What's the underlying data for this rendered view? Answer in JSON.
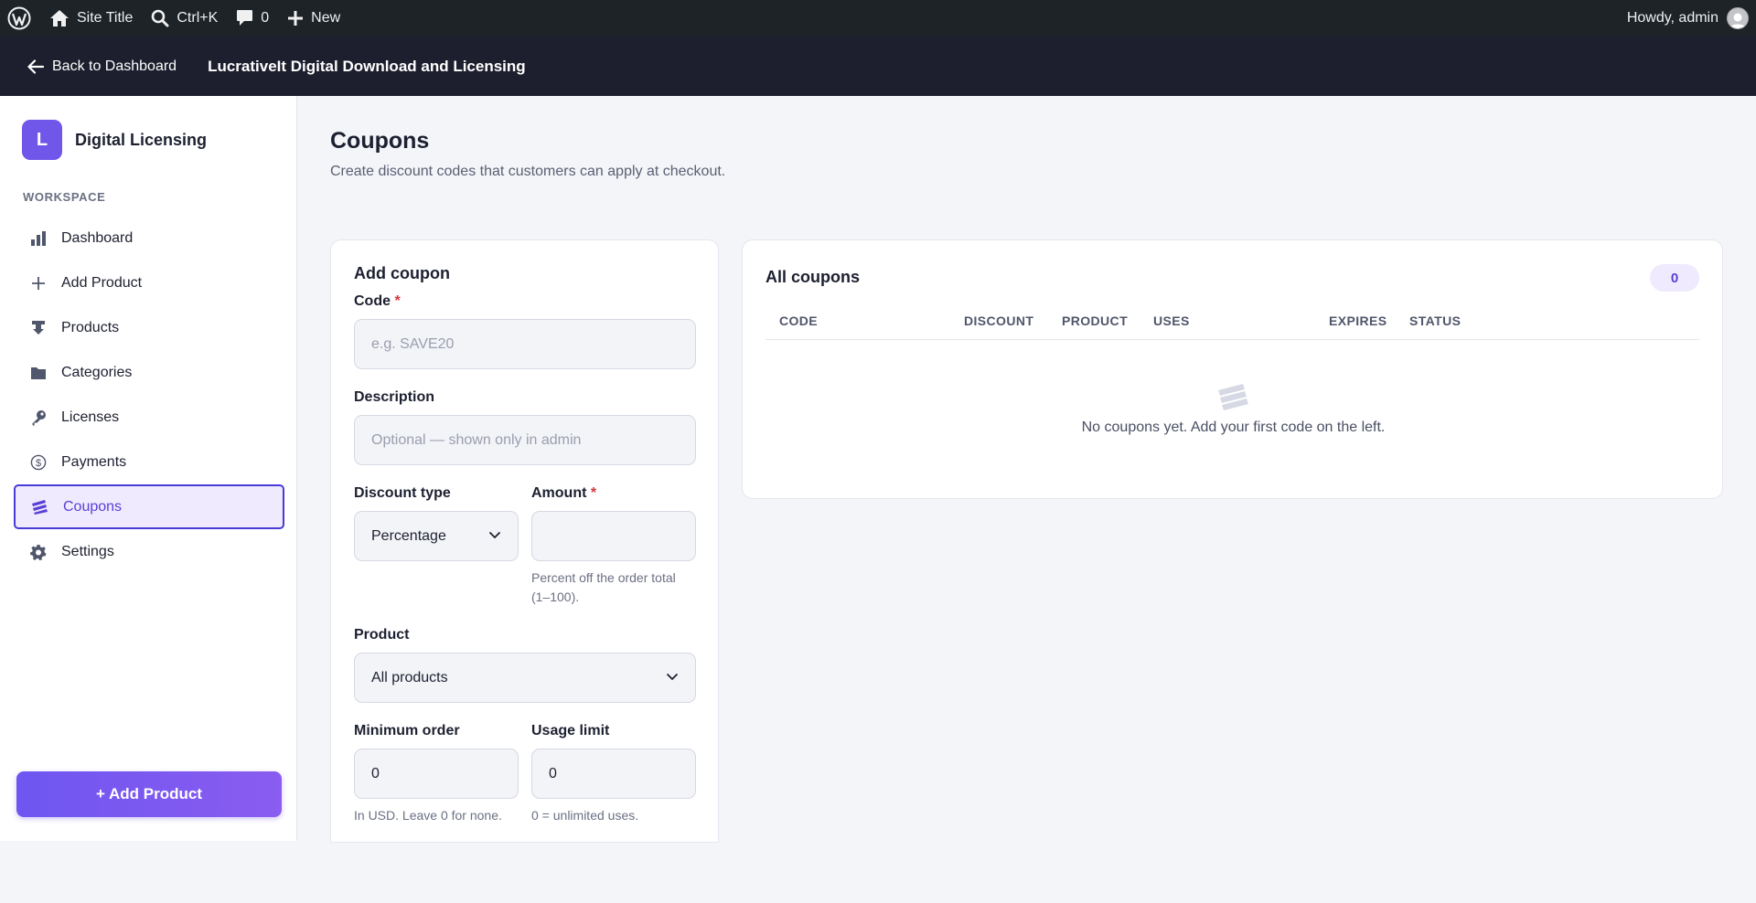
{
  "adminbar": {
    "site_title": "Site Title",
    "search_shortcut": "Ctrl+K",
    "comments_count": "0",
    "new_label": "New",
    "howdy": "Howdy, admin"
  },
  "header": {
    "back_label": "Back to Dashboard",
    "plugin_name": "LucrativeIt Digital Download and Licensing"
  },
  "sidebar": {
    "brand_letter": "L",
    "brand_name": "Digital Licensing",
    "section_label": "WORKSPACE",
    "items": [
      {
        "label": "Dashboard",
        "icon": "bar-chart-icon"
      },
      {
        "label": "Add Product",
        "icon": "plus-icon"
      },
      {
        "label": "Products",
        "icon": "download-icon"
      },
      {
        "label": "Categories",
        "icon": "folder-icon"
      },
      {
        "label": "Licenses",
        "icon": "key-icon"
      },
      {
        "label": "Payments",
        "icon": "dollar-icon"
      },
      {
        "label": "Coupons",
        "icon": "tickets-icon",
        "active": true
      },
      {
        "label": "Settings",
        "icon": "gear-icon"
      }
    ],
    "add_button": "+ Add Product"
  },
  "page": {
    "title": "Coupons",
    "subtitle": "Create discount codes that customers can apply at checkout."
  },
  "form": {
    "title": "Add coupon",
    "code_label": "Code",
    "code_placeholder": "e.g. SAVE20",
    "required_mark": "*",
    "description_label": "Description",
    "description_placeholder": "Optional — shown only in admin",
    "discount_type_label": "Discount type",
    "discount_type_value": "Percentage",
    "amount_label": "Amount",
    "amount_value": "",
    "amount_help": "Percent off the order total (1–100).",
    "product_label": "Product",
    "product_value": "All products",
    "min_order_label": "Minimum order",
    "min_order_value": "0",
    "min_order_help": "In USD. Leave 0 for none.",
    "usage_limit_label": "Usage limit",
    "usage_limit_value": "0",
    "usage_limit_help": "0 = unlimited uses."
  },
  "list": {
    "title": "All coupons",
    "count": "0",
    "columns": [
      "CODE",
      "DISCOUNT",
      "PRODUCT",
      "USES",
      "EXPIRES",
      "STATUS"
    ],
    "empty_text": "No coupons yet. Add your first code on the left."
  },
  "colors": {
    "accent": "#7057ea",
    "admin_bar": "#1d2327",
    "plugin_header": "#1d1f2e",
    "background": "#f4f5f9"
  }
}
